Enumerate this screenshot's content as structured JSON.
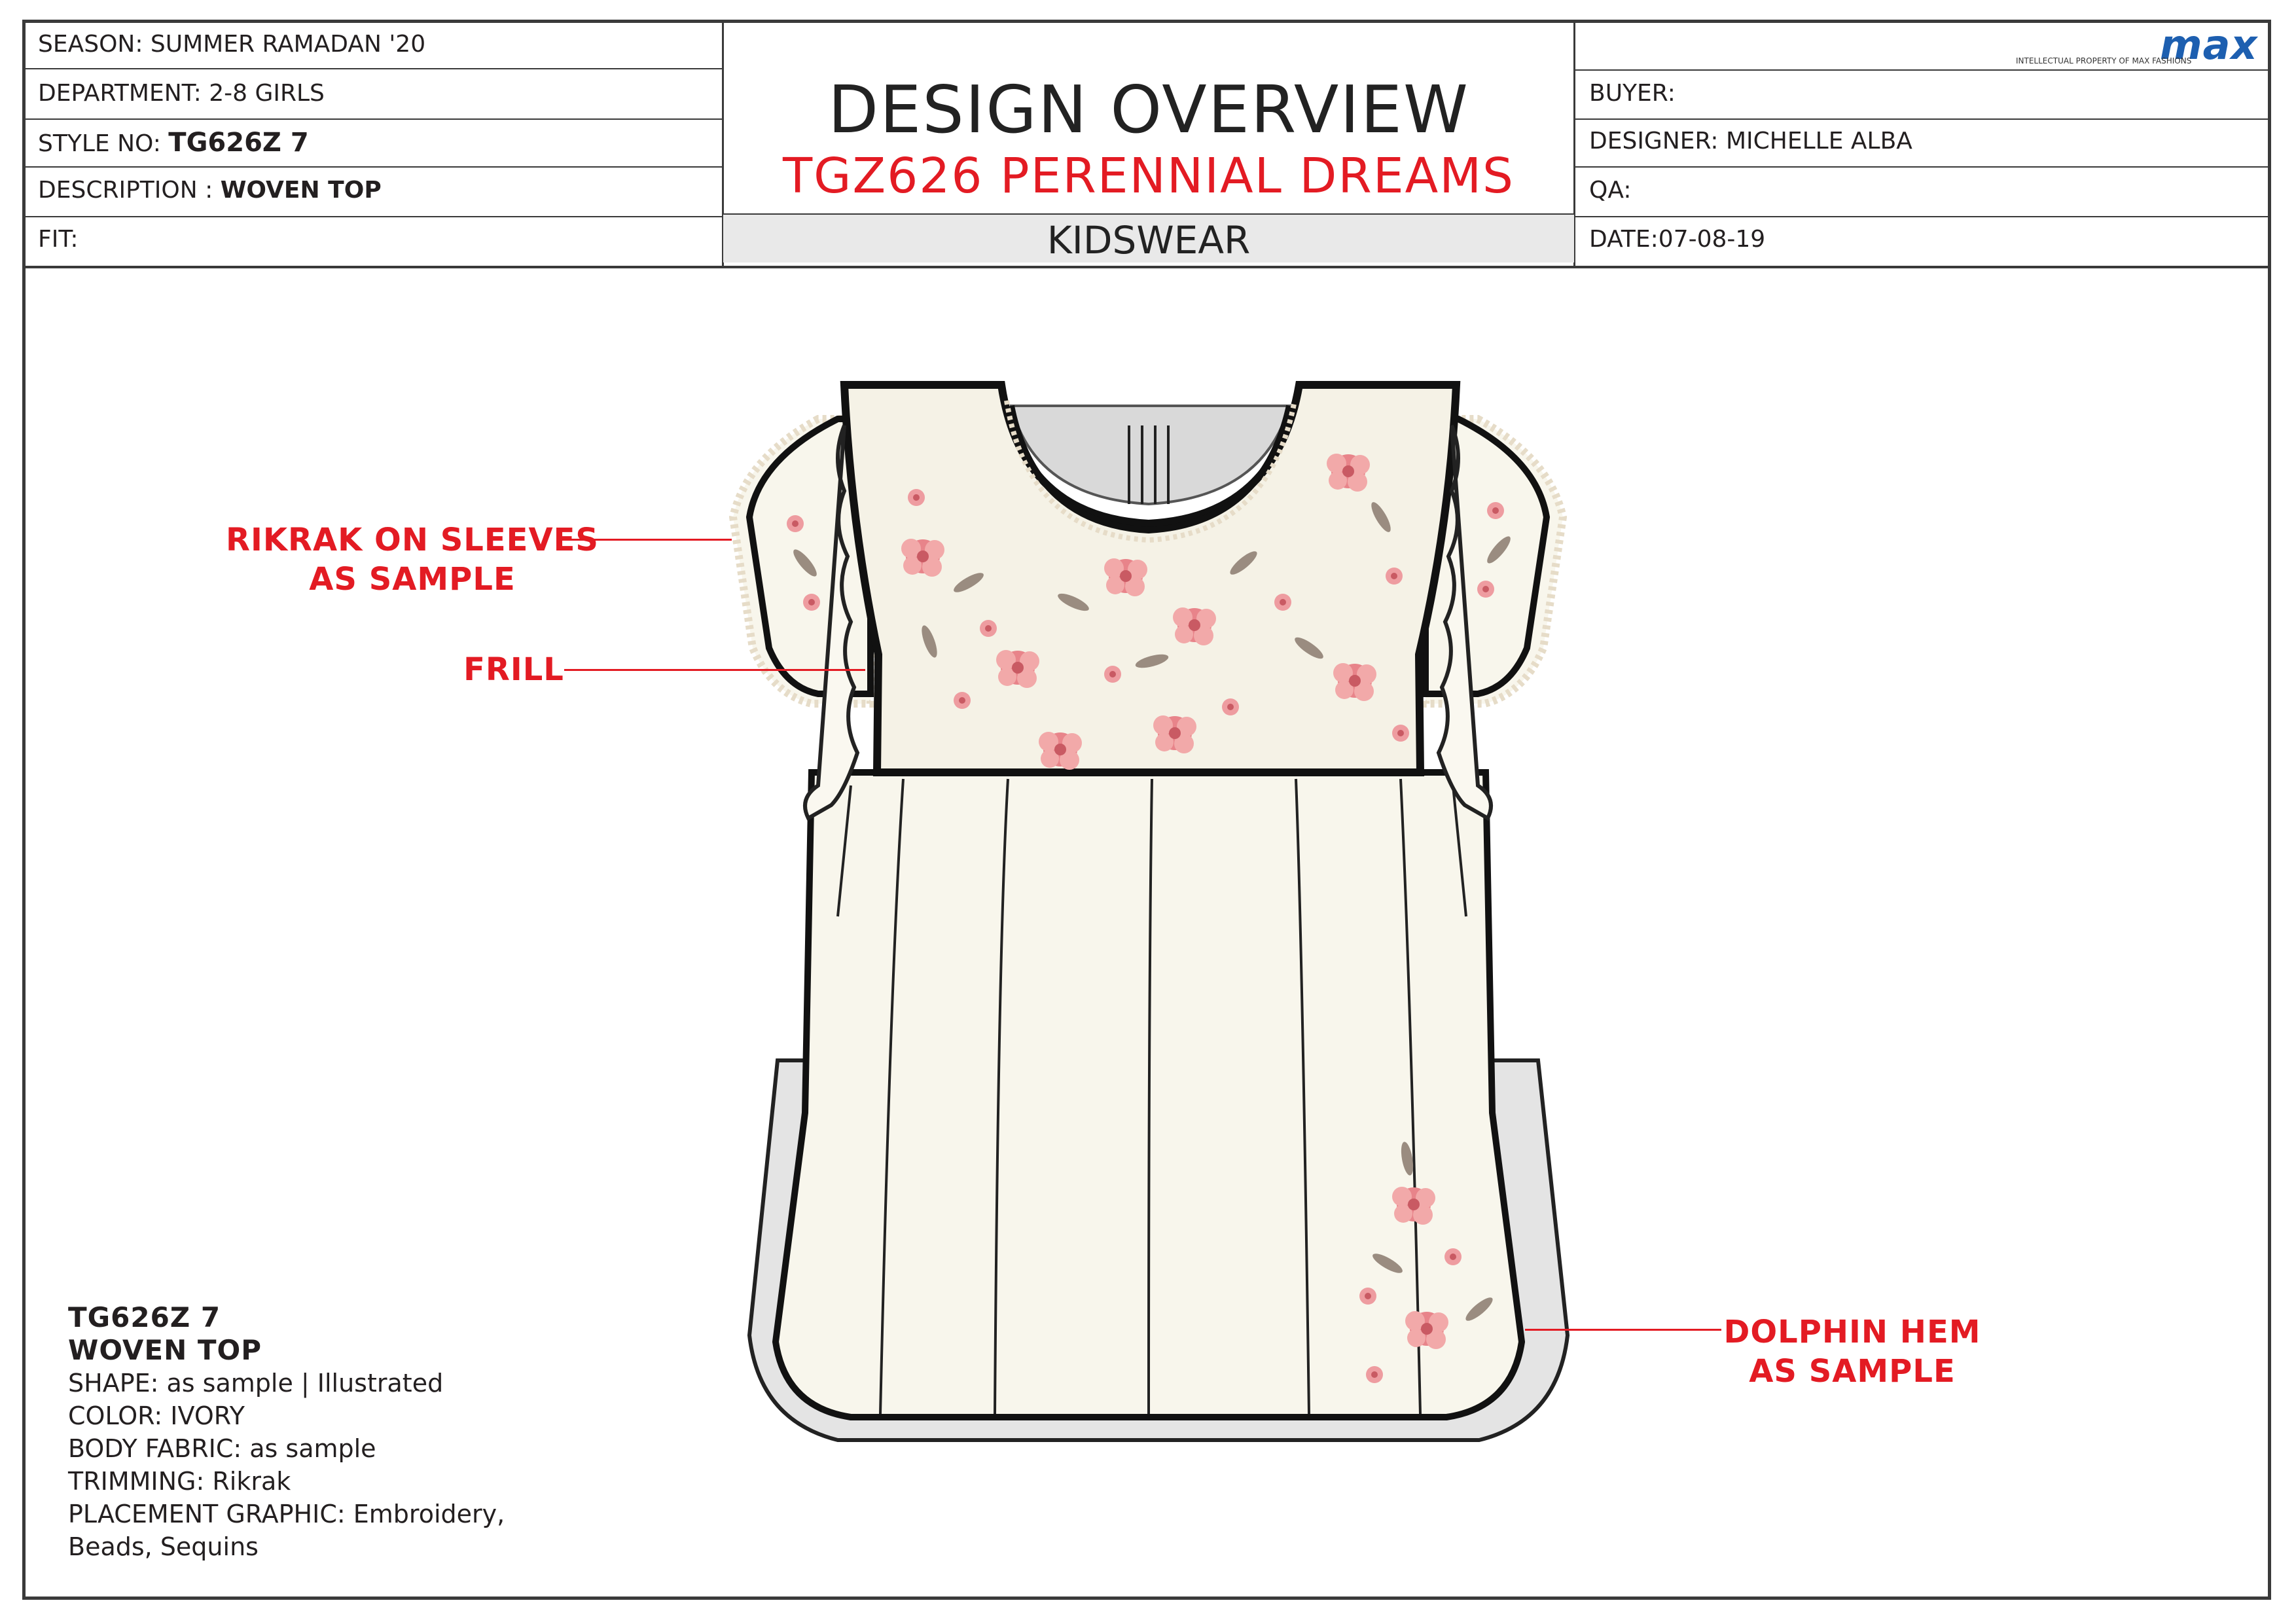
{
  "header": {
    "season": "SEASON: SUMMER RAMADAN '20",
    "department": "DEPARTMENT: 2-8 GIRLS",
    "style_label": "STYLE NO:",
    "style_value": "TG626Z 7",
    "description_label": "DESCRIPTION :",
    "description_value": "WOVEN TOP",
    "fit": "FIT:",
    "title": "DESIGN OVERVIEW",
    "subtitle": "TGZ626 PERENNIAL DREAMS",
    "category": "KIDSWEAR",
    "buyer": "BUYER:",
    "designer": "DESIGNER: MICHELLE ALBA",
    "qa": "QA:",
    "date": "DATE:07-08-19",
    "logo": "max",
    "logo_tagline": "INTELLECTUAL PROPERTY OF MAX FASHIONS"
  },
  "callouts": {
    "rikrak_line1": "RIKRAK ON SLEEVES",
    "rikrak_line2": "AS SAMPLE",
    "frill": "FRILL",
    "dolphin_line1": "DOLPHIN HEM",
    "dolphin_line2": "AS SAMPLE"
  },
  "spec": {
    "style": "TG626Z 7",
    "name": "WOVEN TOP",
    "shape": "SHAPE: as sample | Illustrated",
    "color": "COLOR: IVORY",
    "body_fabric": "BODY FABRIC: as sample",
    "trimming": "TRIMMING: Rikrak",
    "placement_line1": "PLACEMENT GRAPHIC: Embroidery,",
    "placement_line2": "Beads, Sequins"
  },
  "colors": {
    "accent_red": "#e31b23",
    "logo_blue": "#1d5fb0",
    "garment_ivory": "#f8f6ec",
    "flower_pink": "#e8848a"
  }
}
